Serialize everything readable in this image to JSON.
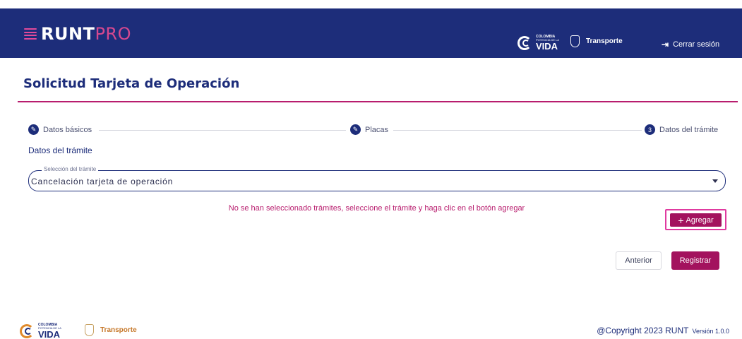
{
  "header": {
    "logo_runt": "RUNT",
    "logo_pro": "PRO",
    "colombia_small1": "COLOMBIA",
    "colombia_small2": "POTENCIA DE LA",
    "colombia_big": "VIDA",
    "transporte": "Transporte",
    "logout_label": "Cerrar sesión",
    "bg_color": "#1d2d7a",
    "accent_color": "#d6488f"
  },
  "page": {
    "title": "Solicitud Tarjeta de Operación"
  },
  "stepper": {
    "steps": [
      {
        "label": "Datos básicos",
        "icon": "pencil-icon",
        "status": "done"
      },
      {
        "label": "Placas",
        "icon": "pencil-icon",
        "status": "done"
      },
      {
        "label": "Datos del trámite",
        "number": "3",
        "status": "current"
      }
    ]
  },
  "form": {
    "section_title": "Datos del trámite",
    "select_legend": "Selección del trámite",
    "select_value": "Cancelación tarjeta de operación",
    "empty_message": "No se han seleccionado trámites, seleccione el trámite y haga clic en el botón agregar",
    "add_plus": "+",
    "add_label": "Agregar"
  },
  "actions": {
    "previous_label": "Anterior",
    "register_label": "Registrar",
    "primary_color": "#a3125e"
  },
  "footer": {
    "colombia_small1": "COLOMBIA",
    "colombia_small2": "POTENCIA DE LA",
    "colombia_big": "VIDA",
    "transporte": "Transporte",
    "copyright": "@Copyright 2023 RUNT",
    "version": "Versión 1.0.0"
  }
}
